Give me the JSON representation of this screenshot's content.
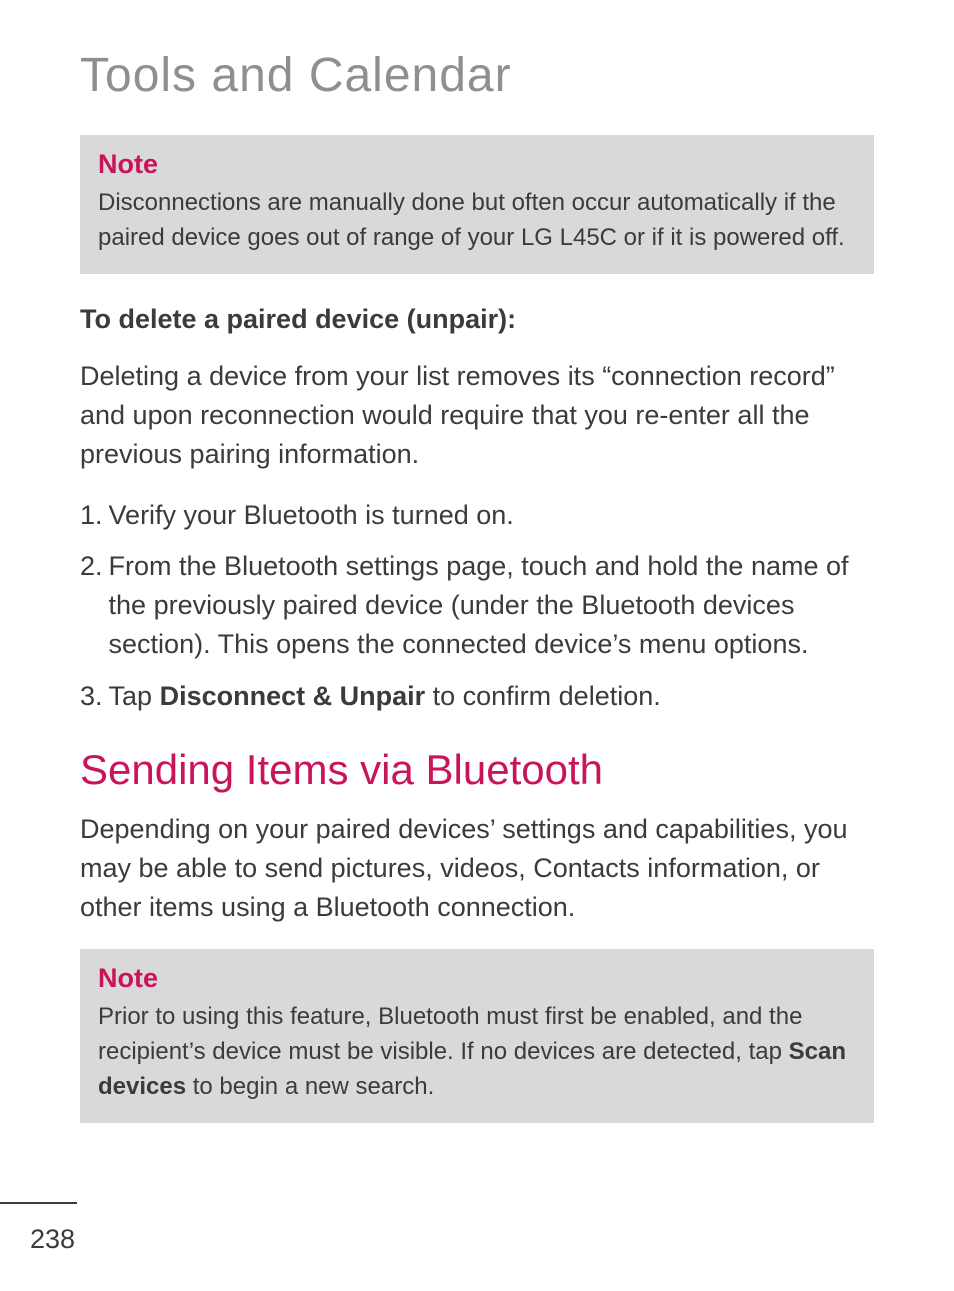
{
  "page": {
    "title": "Tools and Calendar",
    "number": "238"
  },
  "note1": {
    "label": "Note",
    "body": "Disconnections are manually done but often occur automatically if the paired device goes out of range of your LG L45C or if it is powered off."
  },
  "unpair": {
    "heading": "To delete a paired device (unpair):",
    "intro": "Deleting a device from your list removes its “connection record” and upon reconnection would require that you re-enter all the previous pairing information.",
    "steps": {
      "s1": {
        "num": "1.",
        "text": "Verify your Bluetooth is turned on."
      },
      "s2": {
        "num": "2.",
        "text": "From the Bluetooth settings page, touch and hold the name of the previously paired device (under the Bluetooth devices section). This opens the connected device’s menu options."
      },
      "s3": {
        "num": "3.",
        "pre": "Tap ",
        "bold": "Disconnect & Unpair",
        "post": " to confirm deletion."
      }
    }
  },
  "sending": {
    "heading": "Sending Items via Bluetooth",
    "body": "Depending on your paired devices’ settings and capabilities, you may be able to send pictures, videos, Contacts information, or other items using a Bluetooth connection."
  },
  "note2": {
    "label": "Note",
    "pre": "Prior to using this feature, Bluetooth must first be enabled, and the recipient’s device must be visible. If no devices are detected, tap ",
    "bold": "Scan devices",
    "post": " to begin a new search."
  }
}
